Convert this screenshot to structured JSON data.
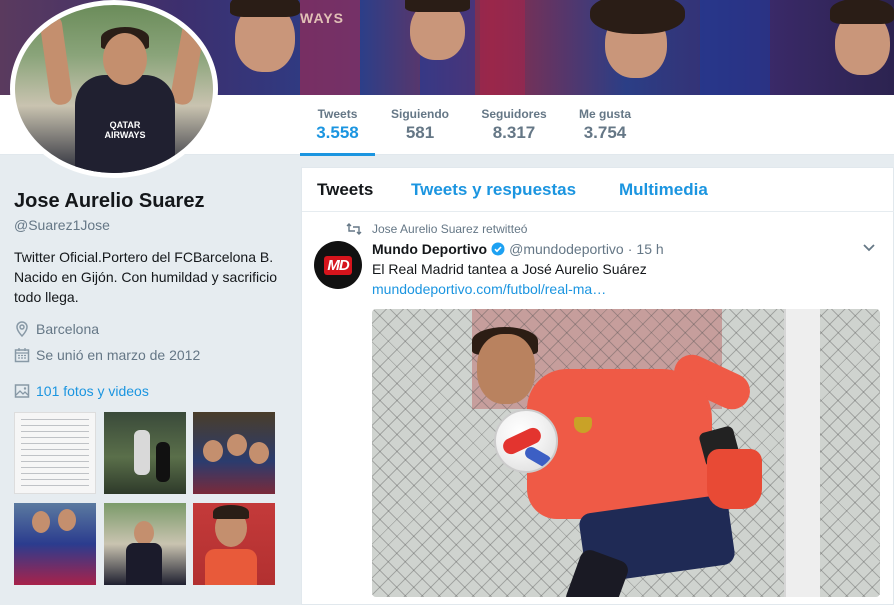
{
  "banner": {
    "text": "WAYS"
  },
  "avatar": {
    "sponsor": "QATAR AIRWAYS"
  },
  "nav": {
    "stats": [
      {
        "label": "Tweets",
        "value": "3.558"
      },
      {
        "label": "Siguiendo",
        "value": "581"
      },
      {
        "label": "Seguidores",
        "value": "8.317"
      },
      {
        "label": "Me gusta",
        "value": "3.754"
      }
    ]
  },
  "profile": {
    "name": "Jose Aurelio Suarez",
    "handle": "@Suarez1Jose",
    "bio": "Twitter Oficial.Portero del FCBarcelona B. Nacido en Gijón. Con humildad y sacrificio todo llega.",
    "location": "Barcelona",
    "joined": "Se unió en marzo de 2012",
    "media_link": "101 fotos y videos"
  },
  "timeline": {
    "tabs": [
      "Tweets",
      "Tweets y respuestas",
      "Multimedia"
    ],
    "tweet": {
      "retweeted_by": "Jose Aurelio Suarez retwitteó",
      "author_name": "Mundo Deportivo",
      "author_handle": "@mundodeportivo",
      "time": "15 h",
      "avatar_text": "MD",
      "text": "El Real Madrid tantea a José Aurelio Suárez",
      "link": "mundodeportivo.com/futbol/real-ma…"
    }
  },
  "colors": {
    "accent": "#1b95e0",
    "text": "#14171a",
    "muted": "#657786",
    "background": "#e6ecf0"
  }
}
